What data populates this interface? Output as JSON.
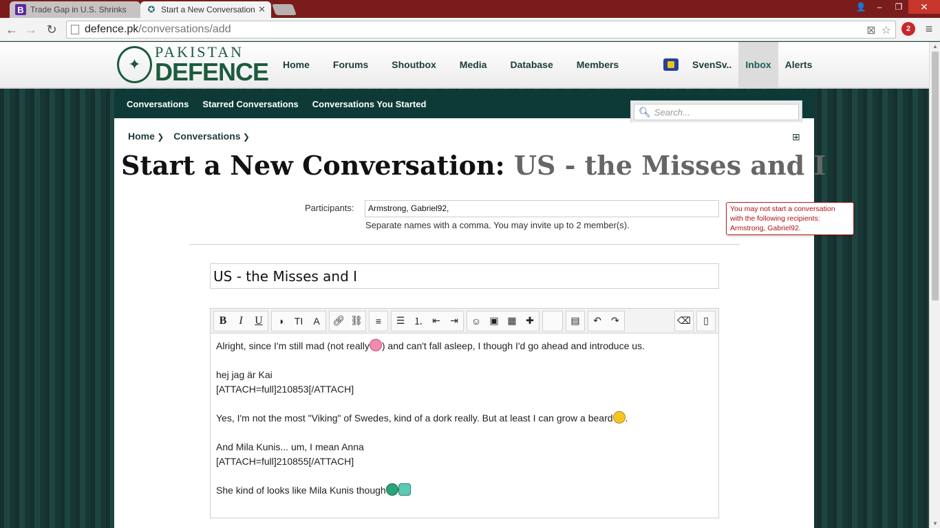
{
  "browser": {
    "tabs": [
      {
        "title": "Trade Gap in U.S. Shrinks",
        "favicon": "B"
      },
      {
        "title": "Start a New Conversation",
        "close": "✕"
      }
    ],
    "url_host": "defence.pk",
    "url_path": "/conversations/add",
    "extension_badge": "2"
  },
  "site": {
    "logo_top": "PAKISTAN",
    "logo_bottom": "DEFENCE",
    "nav": [
      "Home",
      "Forums",
      "Shoutbox",
      "Media",
      "Database",
      "Members"
    ],
    "user_name": "SvenSv..",
    "inbox_label": "Inbox",
    "alerts_label": "Alerts"
  },
  "subnav": [
    "Conversations",
    "Starred Conversations",
    "Conversations You Started"
  ],
  "search": {
    "placeholder": "Search..."
  },
  "breadcrumb": [
    "Home",
    "Conversations"
  ],
  "page": {
    "title_prefix": "Start a New Conversation: ",
    "title_subject": "US - the Misses and I"
  },
  "form": {
    "participants_label": "Participants:",
    "participants_value": "Armstrong, Gabriel92,",
    "participants_hint": "Separate names with a comma. You may invite up to 2 member(s).",
    "error_message": "You may not start a conversation with the following recipients: Armstrong, Gabriel92.",
    "title_value": "US - the Misses and I"
  },
  "editor": {
    "lines": [
      "Alright, since I'm still mad (not really",
      ") and can't fall asleep, I though I'd go ahead and introduce us.",
      "",
      "hej jag är Kai",
      "[ATTACH=full]210853[/ATTACH]",
      "",
      "Yes, I'm not the most \"Viking\" of Swedes, kind of a dork really. But at least I can grow a beard",
      ".",
      "",
      "And Mila Kunis... um, I mean Anna",
      "[ATTACH=full]210855[/ATTACH]",
      "",
      "She kind of looks like Mila Kunis though"
    ]
  },
  "colors": {
    "chrome_frame": "#7a1c1c",
    "site_dark_green": "#0d3a37",
    "error_red": "#b01010"
  }
}
